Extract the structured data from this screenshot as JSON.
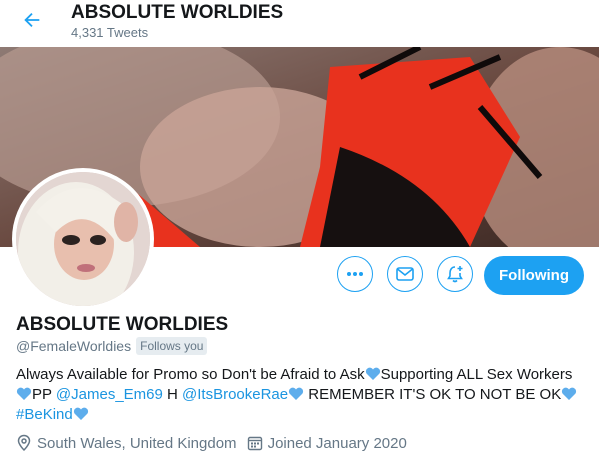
{
  "header": {
    "title": "ABSOLUTE WORLDIES",
    "tweet_count": "4,331 Tweets",
    "back_icon": "arrow-left-icon"
  },
  "profile": {
    "name": "ABSOLUTE WORLDIES",
    "handle": "@FemaleWorldies",
    "follows_you_label": "Follows you",
    "bio": {
      "part1": "Always Available for Promo so Don't be Afraid to Ask",
      "part2": "Supporting ALL Sex Workers",
      "pp_prefix": "PP ",
      "mention1": "@James_Em69",
      "h_text": " H ",
      "mention2": "@ItsBrookeRae",
      "remember": " REMEMBER IT'S OK TO NOT BE OK",
      "hashtag": "#BeKind"
    },
    "location": "South Wales, United Kingdom",
    "joined": "Joined January 2020"
  },
  "actions": {
    "more_icon": "more-icon",
    "message_icon": "envelope-icon",
    "notify_icon": "bell-plus-icon",
    "following_label": "Following"
  },
  "colors": {
    "accent": "#1da1f2",
    "link": "#1b95e0",
    "muted": "#657786",
    "heart": "#5dadec"
  }
}
